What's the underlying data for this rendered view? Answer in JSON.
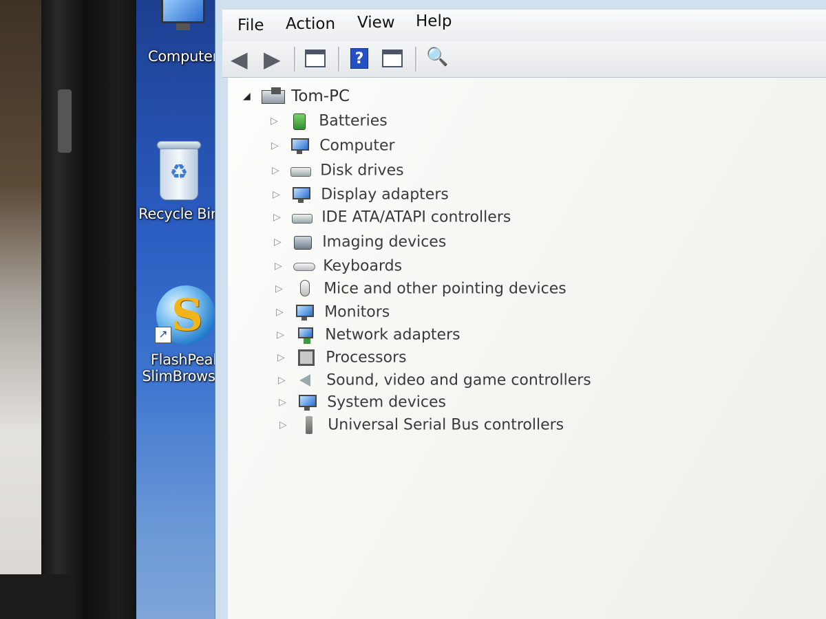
{
  "desktop": {
    "icons": [
      {
        "label": "Computer",
        "icon": "computer-icon"
      },
      {
        "label": "Recycle Bin",
        "icon": "recycle-bin-icon"
      },
      {
        "label_line1": "FlashPeak",
        "label_line2": "SlimBrowser",
        "icon": "slimbrowser-globe-icon"
      }
    ]
  },
  "menu": {
    "file": "File",
    "action": "Action",
    "view": "View",
    "help": "Help"
  },
  "toolbar": {
    "buttons": [
      "back-arrow-icon",
      "forward-arrow-icon",
      "properties-icon",
      "help-icon",
      "update-driver-icon",
      "scan-hardware-icon"
    ],
    "help_glyph": "?"
  },
  "tree": {
    "root": "Tom-PC",
    "categories": [
      "Batteries",
      "Computer",
      "Disk drives",
      "Display adapters",
      "IDE ATA/ATAPI controllers",
      "Imaging devices",
      "Keyboards",
      "Mice and other pointing devices",
      "Monitors",
      "Network adapters",
      "Processors",
      "Sound, video and game controllers",
      "System devices",
      "Universal Serial Bus controllers"
    ]
  },
  "colors": {
    "desktop_blue": "#2a5bbf",
    "window_frame": "#cfe0ef",
    "tree_background": "#f6f6f2"
  }
}
